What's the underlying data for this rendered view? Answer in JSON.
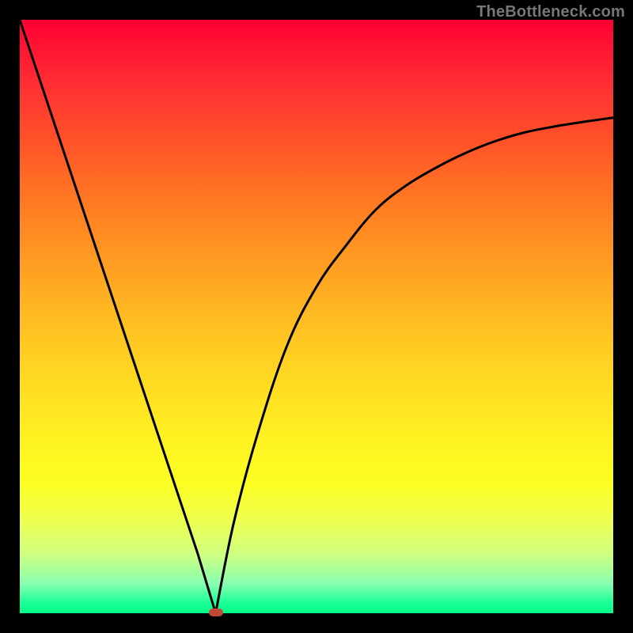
{
  "watermark": "TheBottleneck.com",
  "chart_data": {
    "type": "line",
    "title": "",
    "xlabel": "",
    "ylabel": "",
    "xlim": [
      0,
      100
    ],
    "ylim": [
      0,
      100
    ],
    "series": [
      {
        "name": "curve",
        "x": [
          0,
          5,
          10,
          15,
          20,
          25,
          30,
          33,
          36,
          40,
          45,
          50,
          55,
          60,
          65,
          70,
          75,
          80,
          85,
          90,
          95,
          100
        ],
        "y": [
          100,
          85,
          70,
          55,
          40,
          25,
          10,
          0,
          15,
          30,
          45,
          55,
          62,
          68,
          72,
          75,
          77.5,
          79.5,
          81,
          82,
          82.8,
          83.5
        ]
      }
    ],
    "marker": {
      "x": 33,
      "y": 0
    },
    "background_gradient": {
      "top": "#ff0033",
      "mid": "#ffd822",
      "bottom": "#00ff88"
    }
  }
}
